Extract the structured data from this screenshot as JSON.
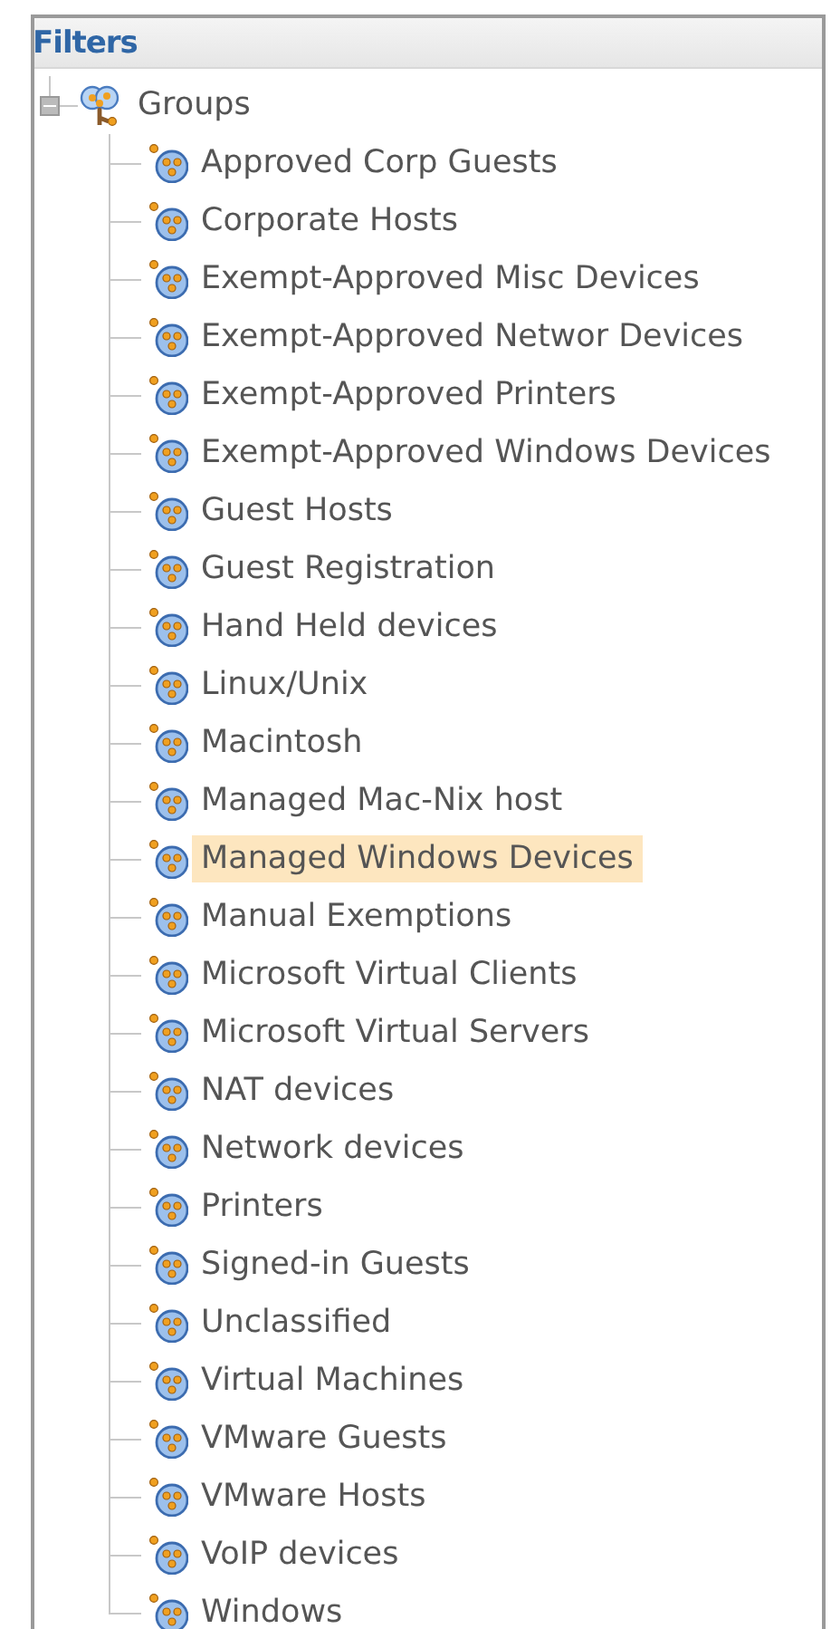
{
  "panel": {
    "title": "Filters",
    "tree": [
      {
        "label": "Groups",
        "expanded": true,
        "selected": false,
        "children": [
          {
            "label": "Approved Corp Guests",
            "selected": false
          },
          {
            "label": "Corporate Hosts",
            "selected": false
          },
          {
            "label": "Exempt-Approved Misc Devices",
            "selected": false
          },
          {
            "label": "Exempt-Approved Networ Devices",
            "selected": false
          },
          {
            "label": "Exempt-Approved Printers",
            "selected": false
          },
          {
            "label": "Exempt-Approved Windows Devices",
            "selected": false
          },
          {
            "label": "Guest Hosts",
            "selected": false
          },
          {
            "label": "Guest Registration",
            "selected": false
          },
          {
            "label": "Hand Held devices",
            "selected": false
          },
          {
            "label": "Linux/Unix",
            "selected": false
          },
          {
            "label": "Macintosh",
            "selected": false
          },
          {
            "label": "Managed Mac-Nix host",
            "selected": false
          },
          {
            "label": "Managed Windows Devices",
            "selected": true
          },
          {
            "label": "Manual Exemptions",
            "selected": false
          },
          {
            "label": "Microsoft Virtual Clients",
            "selected": false
          },
          {
            "label": "Microsoft Virtual Servers",
            "selected": false
          },
          {
            "label": "NAT devices",
            "selected": false
          },
          {
            "label": "Network devices",
            "selected": false
          },
          {
            "label": "Printers",
            "selected": false
          },
          {
            "label": "Signed-in Guests",
            "selected": false
          },
          {
            "label": "Unclassified",
            "selected": false
          },
          {
            "label": "Virtual Machines",
            "selected": false
          },
          {
            "label": "VMware Guests",
            "selected": false
          },
          {
            "label": "VMware Hosts",
            "selected": false
          },
          {
            "label": "VoIP devices",
            "selected": false
          },
          {
            "label": "Windows",
            "selected": false
          }
        ]
      }
    ]
  }
}
